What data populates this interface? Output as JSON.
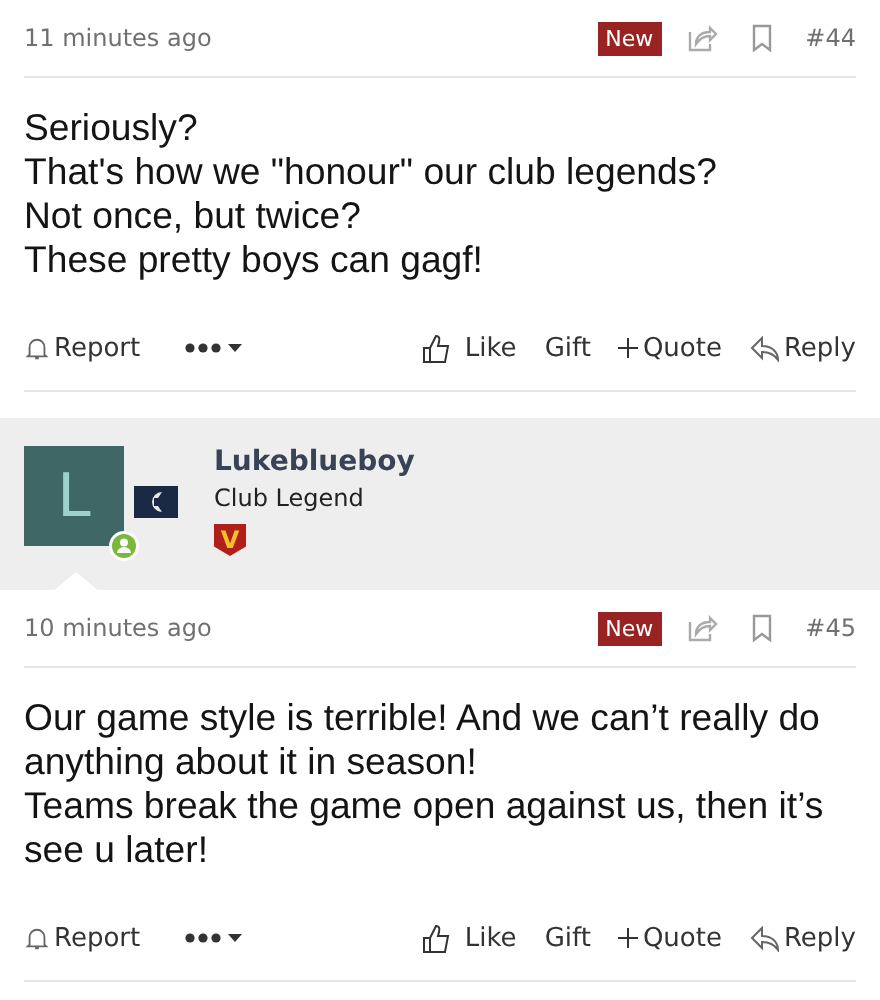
{
  "items": [
    {
      "kind": "post",
      "time": "11 minutes ago",
      "badge": "New",
      "number": "#44",
      "paragraphs": [
        "Seriously?",
        "That's how we \"honour\" our club legends?",
        "Not once, but twice?",
        "These pretty boys can gagf!"
      ],
      "actions": {
        "report": "Report",
        "like": "Like",
        "gift": "Gift",
        "quote": "Quote",
        "reply": "Reply"
      }
    },
    {
      "kind": "author",
      "avatar_letter": "L",
      "online": true,
      "name": "Lukeblueboy",
      "title": "Club Legend",
      "rank_badge": "V"
    },
    {
      "kind": "post",
      "time": "10 minutes ago",
      "badge": "New",
      "number": "#45",
      "paragraphs": [
        "Our game style is terrible! And we can’t really do anything about it in season!",
        "Teams break the game open against us, then it’s see u later!"
      ],
      "actions": {
        "report": "Report",
        "like": "Like",
        "gift": "Gift",
        "quote": "Quote",
        "reply": "Reply"
      }
    }
  ]
}
